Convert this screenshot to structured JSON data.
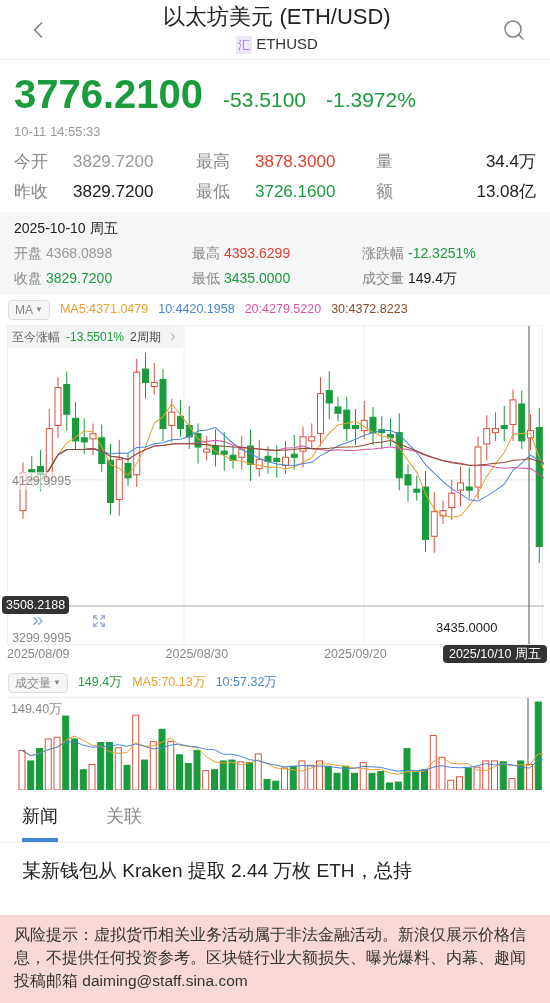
{
  "header": {
    "title": "以太坊美元 (ETH/USD)",
    "badge": "汇",
    "symbol": "ETHUSD"
  },
  "quote": {
    "price": "3776.2100",
    "change": "-53.5100",
    "change_pct": "-1.3972%",
    "time": "10-11 14:55:33"
  },
  "stats": [
    {
      "label": "今开",
      "value": "3829.7200",
      "color": "#999999"
    },
    {
      "label": "最高",
      "value": "3878.3000",
      "color": "#e0402e"
    },
    {
      "label": "量",
      "value": "34.4万",
      "color": "#222222"
    },
    {
      "label": "昨收",
      "value": "3829.7200",
      "color": "#222222"
    },
    {
      "label": "最低",
      "value": "3726.1600",
      "color": "#1a9b3c"
    },
    {
      "label": "额",
      "value": "13.08亿",
      "color": "#222222"
    }
  ],
  "day": {
    "date": "2025-10-10 周五",
    "items": [
      {
        "label": "开盘",
        "value": "4368.0898",
        "color": "#999999"
      },
      {
        "label": "最高",
        "value": "4393.6299",
        "color": "#e0402e"
      },
      {
        "label": "涨跌幅",
        "value": "-12.3251%",
        "color": "#1a9b3c"
      },
      {
        "label": "收盘",
        "value": "3829.7200",
        "color": "#1a9b3c"
      },
      {
        "label": "最低",
        "value": "3435.0000",
        "color": "#1a9b3c"
      },
      {
        "label": "成交量",
        "value": "149.4万",
        "color": "#222222"
      }
    ]
  },
  "ma_legend": {
    "selector": "MA",
    "caret": "▼",
    "items": [
      {
        "text": "MA5:4371.0479",
        "color": "#e8a230"
      },
      {
        "text": "10:4420.1958",
        "color": "#4a86d8"
      },
      {
        "text": "20:4279.5220",
        "color": "#d455a6"
      },
      {
        "text": "30:4372.8223",
        "color": "#8a4a2a"
      }
    ]
  },
  "chart": {
    "overlay": {
      "label": "至今涨幅",
      "value": "-13.5501%",
      "period": "2周期"
    },
    "axis_labels": [
      "4129.9995",
      "3299.9995"
    ],
    "crosshair_price": "3508.2188",
    "low_marker": "3435.0000",
    "x_labels": [
      "2025/08/09",
      "2025/08/30",
      "2025/09/20"
    ],
    "crosshair_date": "2025/10/10 周五"
  },
  "volume": {
    "selector": "成交量",
    "caret": "▼",
    "items": [
      {
        "text": "149.4万",
        "color": "#1a9b3c"
      },
      {
        "text": "MA5:70.13万",
        "color": "#e8a230"
      },
      {
        "text": "10:57.32万",
        "color": "#4a86d8"
      }
    ],
    "axis_label": "149.40万"
  },
  "tabs": [
    {
      "label": "新闻",
      "selected": true
    },
    {
      "label": "关联",
      "selected": false
    }
  ],
  "news": [
    "某新钱包从 Kraken 提取 2.44 万枚 ETH，总持"
  ],
  "risk_notice": "风险提示：虚拟货币相关业务活动属于非法金融活动。新浪仅展示价格信息，不提供任何投资参考。区块链行业大额损失、曝光爆料、内幕、趣闻投稿邮箱 daiming@staff.sina.com"
}
